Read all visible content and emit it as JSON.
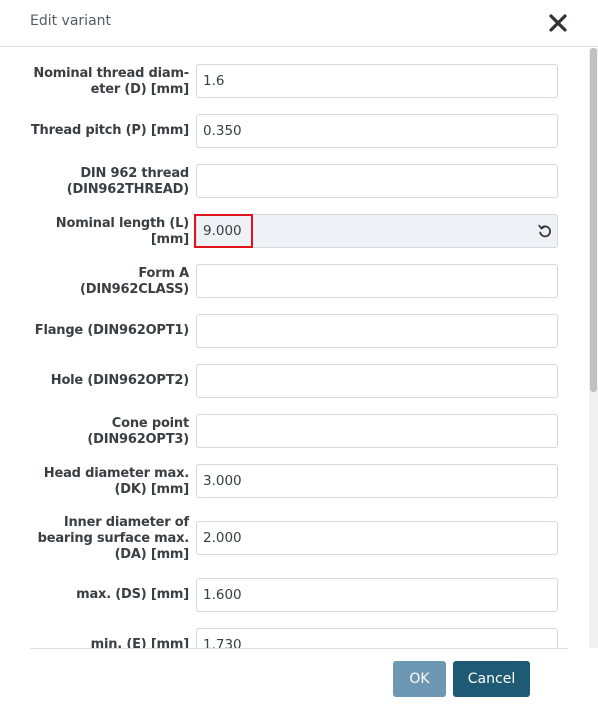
{
  "dialog": {
    "title": "Edit variant",
    "close_icon": "close-icon"
  },
  "fields": [
    {
      "label": "Nominal thread diam-\neter (D) [mm]",
      "value": "1.6"
    },
    {
      "label": "Thread pitch (P) [mm]",
      "value": "0.350"
    },
    {
      "label": "DIN 962 thread\n(DIN962THREAD)",
      "value": ""
    },
    {
      "label": "Nominal length (L)\n[mm]",
      "value": "9.000",
      "readonly": true,
      "highlighted": true,
      "reset_icon": "reset-icon"
    },
    {
      "label": "Form A\n(DIN962CLASS)",
      "value": ""
    },
    {
      "label": "Flange (DIN962OPT1)",
      "value": ""
    },
    {
      "label": "Hole (DIN962OPT2)",
      "value": ""
    },
    {
      "label": "Cone point\n(DIN962OPT3)",
      "value": ""
    },
    {
      "label": "Head diameter max.\n(DK) [mm]",
      "value": "3.000"
    },
    {
      "label": "Inner diameter of\nbearing surface max.\n(DA) [mm]",
      "value": "2.000"
    },
    {
      "label": "max. (DS) [mm]",
      "value": "1.600"
    },
    {
      "label": "min. (E) [mm]",
      "value": "1.730"
    }
  ],
  "footer": {
    "ok_label": "OK",
    "cancel_label": "Cancel"
  },
  "colors": {
    "highlight": "#e0141d",
    "ok_button": "#6e97b3",
    "cancel_button": "#1f5a75",
    "readonly_field": "#eef1f5"
  }
}
